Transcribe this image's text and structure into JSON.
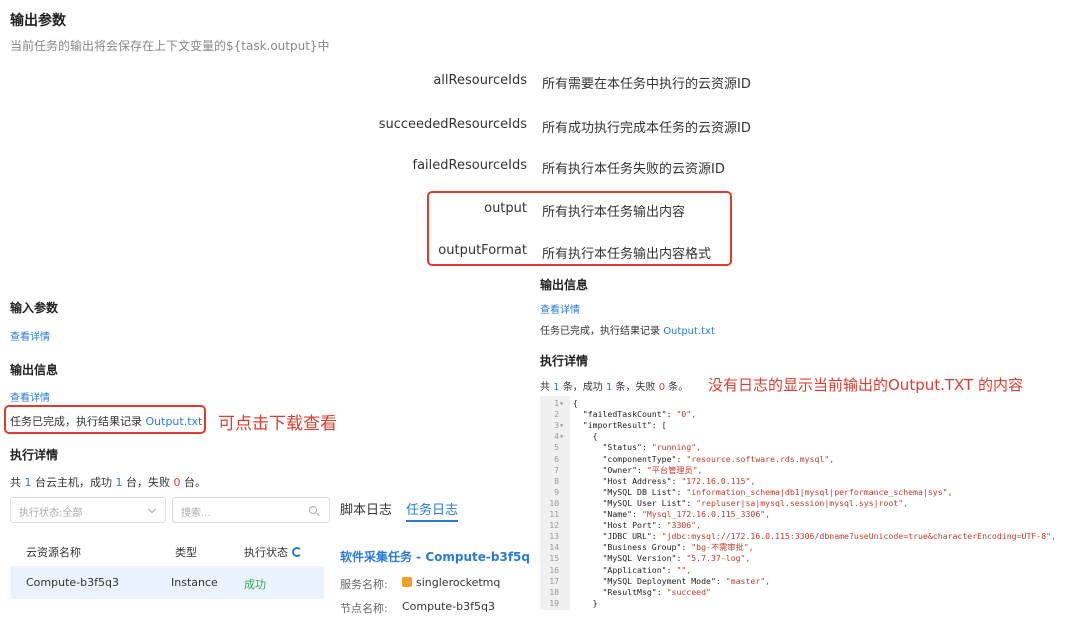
{
  "header": {
    "title": "输出参数",
    "subtitle": "当前任务的输出将会保存在上下文变量的${task.output}中"
  },
  "params": [
    {
      "name": "allResourceIds",
      "desc": "所有需要在本任务中执行的云资源ID"
    },
    {
      "name": "succeededResourceIds",
      "desc": "所有成功执行完成本任务的云资源ID"
    },
    {
      "name": "failedResourceIds",
      "desc": "所有执行本任务失败的云资源ID"
    },
    {
      "name": "output",
      "desc": "所有执行本任务输出内容"
    },
    {
      "name": "outputFormat",
      "desc": "所有执行本任务输出内容格式"
    }
  ],
  "left": {
    "input_title": "输入参数",
    "input_link": "查看详情",
    "output_title": "输出信息",
    "output_link": "查看详情",
    "done_text": "任务已完成，执行结果记录",
    "output_file": "Output.txt",
    "annotation": "可点击下载查看",
    "exec_title": "执行详情",
    "summary": {
      "prefix": "共",
      "total": "1",
      "mid1": "台云主机，成功",
      "success": "1",
      "mid2": "台，失败",
      "failed": "0",
      "suffix": "台。"
    },
    "status_select": "执行状态:全部",
    "search_placeholder": "搜索...",
    "table": {
      "headers": [
        "云资源名称",
        "类型",
        "执行状态"
      ],
      "rows": [
        {
          "name": "Compute-b3f5q3",
          "type": "Instance",
          "status": "成功"
        }
      ]
    }
  },
  "tabs": {
    "items": [
      "脚本日志",
      "任务日志"
    ],
    "active": 1
  },
  "task_panel": {
    "title": "软件采集任务 - Compute-b3f5q",
    "service_label": "服务名称:",
    "service_value": "singlerocketmq",
    "node_label": "节点名称:",
    "node_value": "Compute-b3f5q3"
  },
  "right": {
    "output_title": "输出信息",
    "output_link": "查看详情",
    "done_text": "任务已完成，执行结果记录",
    "output_file": "Output.txt",
    "exec_title": "执行详情",
    "summary": {
      "prefix": "共",
      "total": "1",
      "mid1": "条，成功",
      "success": "1",
      "mid2": "条，失败",
      "failed": "0",
      "suffix": "条。"
    },
    "annotation": "没有日志的显示当前输出的Output.TXT 的内容"
  },
  "code_lines": [
    {
      "n": "1",
      "fold": true,
      "indent": "",
      "k": "{",
      "v": ""
    },
    {
      "n": "2",
      "fold": false,
      "indent": "  ",
      "k": "\"failedTaskCount\": ",
      "v": "\"0\","
    },
    {
      "n": "3",
      "fold": true,
      "indent": "  ",
      "k": "\"importResult\": [",
      "v": ""
    },
    {
      "n": "4",
      "fold": true,
      "indent": "    ",
      "k": "{",
      "v": ""
    },
    {
      "n": "5",
      "fold": false,
      "indent": "      ",
      "k": "\"Status\": ",
      "v": "\"running\","
    },
    {
      "n": "6",
      "fold": false,
      "indent": "      ",
      "k": "\"componentType\": ",
      "v": "\"resource.software.rds.mysql\","
    },
    {
      "n": "7",
      "fold": false,
      "indent": "      ",
      "k": "\"Owner\": ",
      "v": "\"平台管理员\","
    },
    {
      "n": "8",
      "fold": false,
      "indent": "      ",
      "k": "\"Host Address\": ",
      "v": "\"172.16.0.115\","
    },
    {
      "n": "9",
      "fold": false,
      "indent": "      ",
      "k": "\"MySQL DB List\": ",
      "v": "\"information_schema|db1|mysql|performance_schema|sys\","
    },
    {
      "n": "10",
      "fold": false,
      "indent": "      ",
      "k": "\"MySQL User List\": ",
      "v": "\"repluser|sa|mysql.session|mysql.sys|root\","
    },
    {
      "n": "11",
      "fold": false,
      "indent": "      ",
      "k": "\"Name\": ",
      "v": "\"Mysql_172.16.0.115_3306\","
    },
    {
      "n": "12",
      "fold": false,
      "indent": "      ",
      "k": "\"Host Port\": ",
      "v": "\"3306\","
    },
    {
      "n": "13",
      "fold": false,
      "indent": "      ",
      "k": "\"JDBC URL\": ",
      "v": "\"jdbc:mysql://172.16.0.115:3306/dbname?useUnicode=true&characterEncoding=UTF-8\","
    },
    {
      "n": "14",
      "fold": false,
      "indent": "      ",
      "k": "\"Business Group\": ",
      "v": "\"bg-不需审批\","
    },
    {
      "n": "15",
      "fold": false,
      "indent": "      ",
      "k": "\"MySQL Version\": ",
      "v": "\"5.7.37-log\","
    },
    {
      "n": "16",
      "fold": false,
      "indent": "      ",
      "k": "\"Application\": ",
      "v": "\"\","
    },
    {
      "n": "17",
      "fold": false,
      "indent": "      ",
      "k": "\"MySQL Deployment Mode\": ",
      "v": "\"master\","
    },
    {
      "n": "18",
      "fold": false,
      "indent": "      ",
      "k": "\"ResultMsg\": ",
      "v": "\"succeed\""
    },
    {
      "n": "19",
      "fold": false,
      "indent": "    ",
      "k": "}",
      "v": ""
    }
  ]
}
